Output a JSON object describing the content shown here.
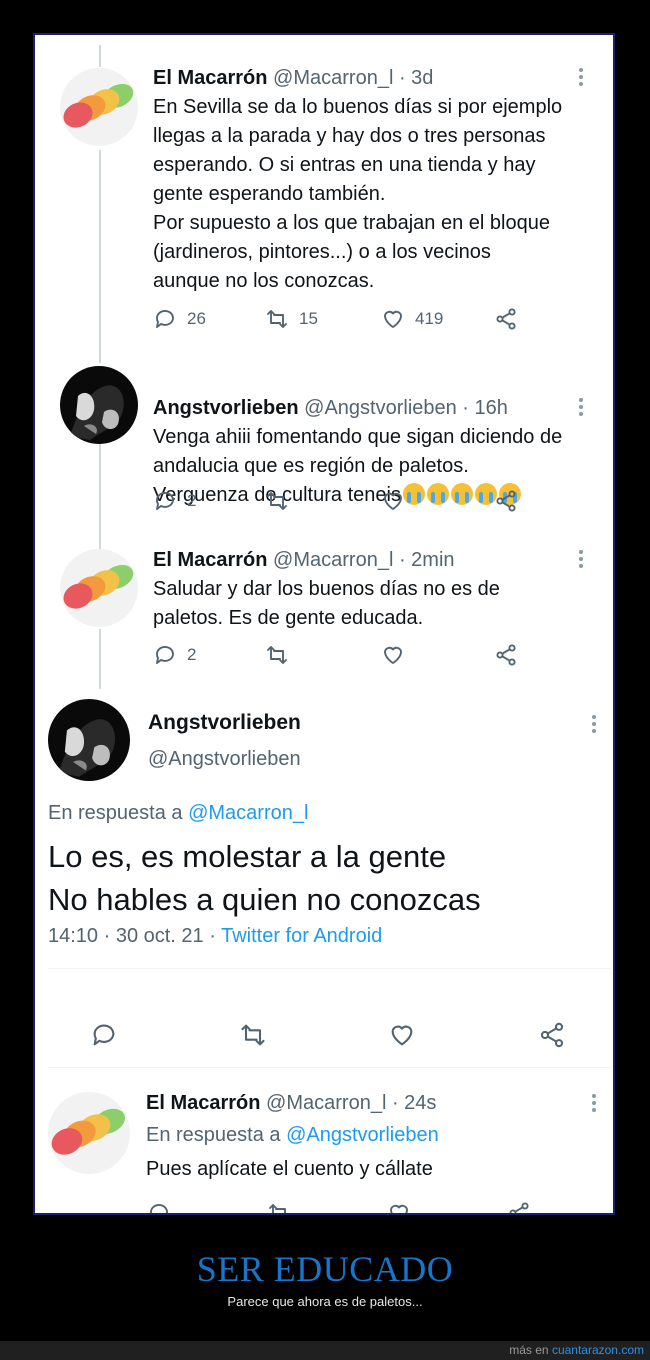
{
  "tweets": [
    {
      "name": "El Macarrón",
      "meta": "@Macarron_l · 3d",
      "text": "En Sevilla se da lo buenos días si por ejemplo\nllegas a la parada y hay dos o tres personas\nesperando. O si entras en una tienda y hay\ngente esperando también.\nPor supuesto a los que trabajan en el bloque\n(jardineros, pintores...) o a los vecinos\naunque no los conozcas.",
      "replies": "26",
      "retweets": "15",
      "likes": "419"
    },
    {
      "name": "Angstvorlieben",
      "meta": "@Angstvorlieben · 16h",
      "text": "Venga ahiii fomentando que sigan diciendo de\nandalucia que es región de paletos.\nVerguenza de cultura teneis",
      "emoji": "loudly-crying-face",
      "replies": "2",
      "retweets": "",
      "likes": ""
    },
    {
      "name": "El Macarrón",
      "meta": "@Macarron_l · 2min",
      "text": "Saludar y dar los buenos días no es de\npaletos. Es de gente educada.",
      "replies": "2",
      "retweets": "",
      "likes": ""
    }
  ],
  "main": {
    "name": "Angstvorlieben",
    "handle": "@Angstvorlieben",
    "reply_prefix": "En respuesta a",
    "reply_to": "@Macarron_l",
    "line1": "Lo es, es molestar a la gente",
    "line2": "No hables a quien no conozcas",
    "timestamp": "14:10 · 30 oct. 21 ·",
    "source": "Twitter for Android"
  },
  "last": {
    "name": "El Macarrón",
    "meta": "@Macarron_l · 24s",
    "reply_prefix": "En respuesta a",
    "reply_to": "@Angstvorlieben",
    "text": "Pues aplícate el cuento y cállate"
  },
  "footer": {
    "title": "SER EDUCADO",
    "subtitle": "Parece que ahora es de paletos...",
    "more_prefix": "más en",
    "site": "cuantarazon.com"
  },
  "colors": {
    "link": "#1d9bf0",
    "title": "#1875c9",
    "frame_border": "#1d1f6e"
  }
}
